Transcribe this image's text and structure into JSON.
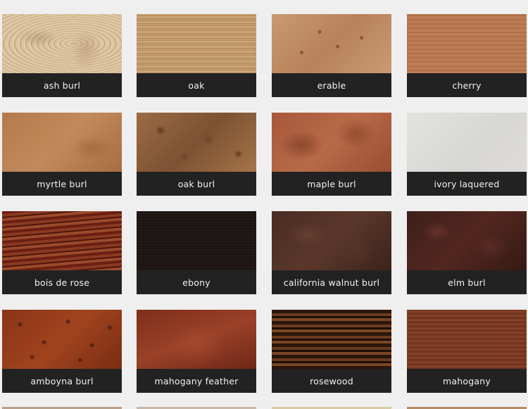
{
  "veneers": [
    {
      "label": "ash burl"
    },
    {
      "label": "oak"
    },
    {
      "label": "erable"
    },
    {
      "label": "cherry"
    },
    {
      "label": "myrtle burl"
    },
    {
      "label": "oak burl"
    },
    {
      "label": "maple burl"
    },
    {
      "label": "ivory laquered"
    },
    {
      "label": "bois de rose"
    },
    {
      "label": "ebony"
    },
    {
      "label": "california walnut burl"
    },
    {
      "label": "elm burl"
    },
    {
      "label": "amboyna burl"
    },
    {
      "label": "mahogany feather"
    },
    {
      "label": "rosewood"
    },
    {
      "label": "mahogany"
    }
  ],
  "colors": {
    "page_background": "#efefef",
    "label_bar": "#222222",
    "label_text": "#f2f2f2"
  }
}
